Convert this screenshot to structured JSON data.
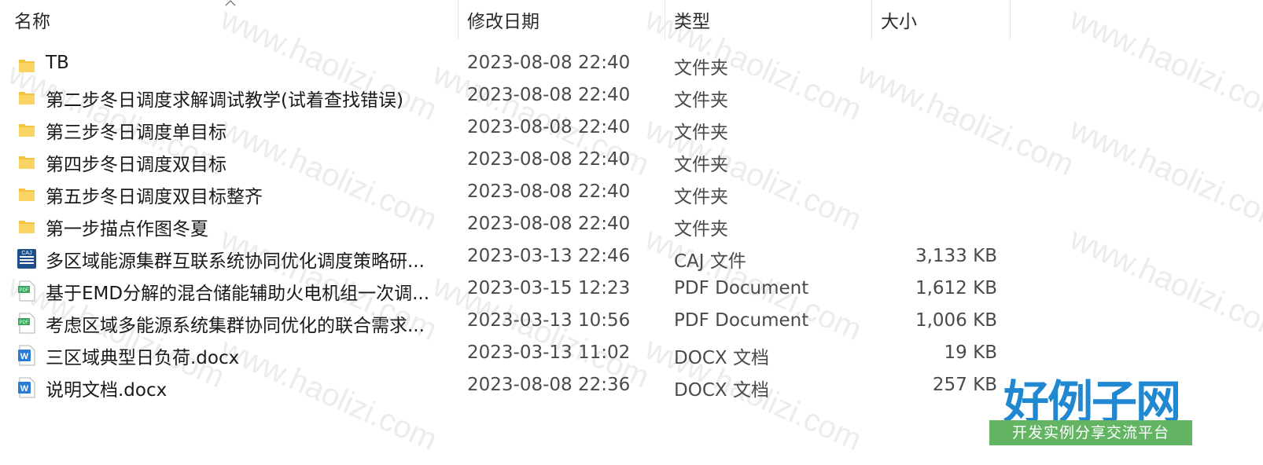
{
  "columns": {
    "name": "名称",
    "date": "修改日期",
    "type": "类型",
    "size": "大小"
  },
  "files": [
    {
      "icon": "folder-icon",
      "name": "TB",
      "date": "2023-08-08 22:40",
      "type": "文件夹",
      "size": ""
    },
    {
      "icon": "folder-icon",
      "name": "第二步冬日调度求解调试教学(试着查找错误)",
      "date": "2023-08-08 22:40",
      "type": "文件夹",
      "size": ""
    },
    {
      "icon": "folder-icon",
      "name": "第三步冬日调度单目标",
      "date": "2023-08-08 22:40",
      "type": "文件夹",
      "size": ""
    },
    {
      "icon": "folder-icon",
      "name": "第四步冬日调度双目标",
      "date": "2023-08-08 22:40",
      "type": "文件夹",
      "size": ""
    },
    {
      "icon": "folder-icon",
      "name": "第五步冬日调度双目标整齐",
      "date": "2023-08-08 22:40",
      "type": "文件夹",
      "size": ""
    },
    {
      "icon": "folder-icon",
      "name": "第一步描点作图冬夏",
      "date": "2023-08-08 22:40",
      "type": "文件夹",
      "size": ""
    },
    {
      "icon": "caj-file-icon",
      "name": "多区域能源集群互联系统协同优化调度策略研...",
      "date": "2023-03-13 22:46",
      "type": "CAJ 文件",
      "size": "3,133 KB"
    },
    {
      "icon": "pdf-file-icon",
      "name": "基于EMD分解的混合储能辅助火电机组一次调...",
      "date": "2023-03-15 12:23",
      "type": "PDF Document",
      "size": "1,612 KB"
    },
    {
      "icon": "pdf-file-icon",
      "name": "考虑区域多能源系统集群协同优化的联合需求...",
      "date": "2023-03-13 10:56",
      "type": "PDF Document",
      "size": "1,006 KB"
    },
    {
      "icon": "docx-file-icon",
      "name": "三区域典型日负荷.docx",
      "date": "2023-03-13 11:02",
      "type": "DOCX 文档",
      "size": "19 KB"
    },
    {
      "icon": "docx-file-icon",
      "name": "说明文档.docx",
      "date": "2023-08-08 22:36",
      "type": "DOCX 文档",
      "size": "257 KB"
    }
  ],
  "icon_labels": {
    "caj": "CAJ",
    "pdf": "PDF",
    "docx": "W"
  },
  "watermark": "www.haolizi.com",
  "brand": {
    "title": "好例子网",
    "subtitle": "开发实例分享交流平台"
  },
  "colors": {
    "folder": "#f5c342",
    "docx": "#2b7cd3",
    "pdf": "#3aa55d",
    "caj": "#1e4f8a",
    "brand_blue": "#1f88d0",
    "brand_green": "#63b564"
  }
}
